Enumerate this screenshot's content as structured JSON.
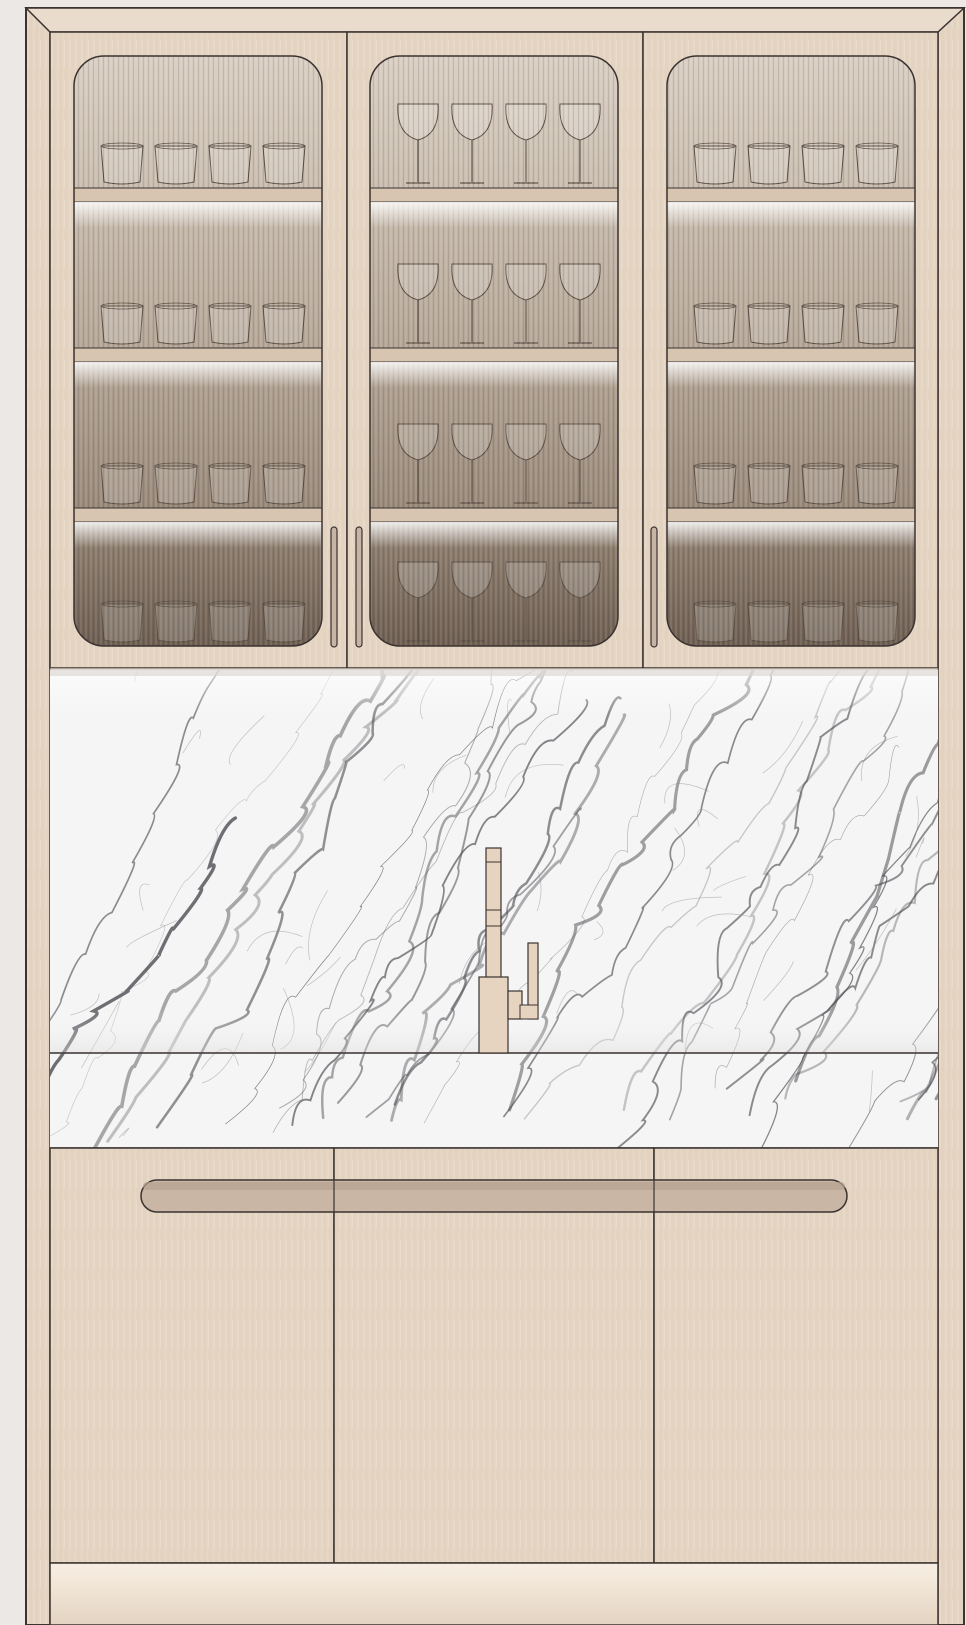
{
  "palette": {
    "background": "#ece8e6",
    "wood": "#e6d6c4",
    "wood_dark": "#d8c4ae",
    "outline": "#3a3330",
    "glass_top": "#d6cbbf",
    "glass_bottom": "#6e5f52",
    "marble_base": "#f4f4f4",
    "marble_vein": "#4c4c52",
    "handle": "#b9a897"
  },
  "cabinet": {
    "upper_doors": [
      {
        "name": "left-glass-door",
        "contents": "tumbler-glasses",
        "shelves": 4
      },
      {
        "name": "center-glass-door",
        "contents": "wine-glasses",
        "shelves": 4
      },
      {
        "name": "right-glass-door",
        "contents": "tumbler-glasses",
        "shelves": 4
      }
    ],
    "glasses_per_shelf": 4,
    "lower_doors": 3,
    "upper_door_handles": 3,
    "fixtures": [
      "faucet",
      "toe-kick-light"
    ]
  }
}
